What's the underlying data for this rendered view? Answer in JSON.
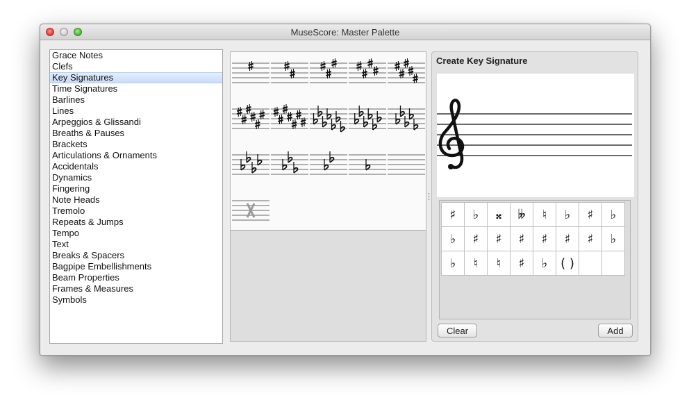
{
  "window": {
    "title": "MuseScore: Master Palette"
  },
  "categories": [
    {
      "label": "Grace Notes"
    },
    {
      "label": "Clefs"
    },
    {
      "label": "Key Signatures",
      "selected": true
    },
    {
      "label": "Time Signatures"
    },
    {
      "label": "Barlines"
    },
    {
      "label": "Lines"
    },
    {
      "label": "Arpeggios & Glissandi"
    },
    {
      "label": "Breaths & Pauses"
    },
    {
      "label": "Brackets"
    },
    {
      "label": "Articulations & Ornaments"
    },
    {
      "label": "Accidentals"
    },
    {
      "label": "Dynamics"
    },
    {
      "label": "Fingering"
    },
    {
      "label": "Note Heads"
    },
    {
      "label": "Tremolo"
    },
    {
      "label": "Repeats & Jumps"
    },
    {
      "label": "Tempo"
    },
    {
      "label": "Text"
    },
    {
      "label": "Breaks & Spacers"
    },
    {
      "label": "Bagpipe Embellishments"
    },
    {
      "label": "Beam Properties"
    },
    {
      "label": "Frames & Measures"
    },
    {
      "label": "Symbols"
    }
  ],
  "key_signature_palette": [
    {
      "name": "G major",
      "accidental": "sharp",
      "count": 1
    },
    {
      "name": "D major",
      "accidental": "sharp",
      "count": 2
    },
    {
      "name": "A major",
      "accidental": "sharp",
      "count": 3
    },
    {
      "name": "E major",
      "accidental": "sharp",
      "count": 4
    },
    {
      "name": "B major",
      "accidental": "sharp",
      "count": 5
    },
    {
      "name": "F# major",
      "accidental": "sharp",
      "count": 6
    },
    {
      "name": "C# major",
      "accidental": "sharp",
      "count": 7
    },
    {
      "name": "Cb major",
      "accidental": "flat",
      "count": 7
    },
    {
      "name": "Gb major",
      "accidental": "flat",
      "count": 6
    },
    {
      "name": "Db major",
      "accidental": "flat",
      "count": 5
    },
    {
      "name": "Ab major",
      "accidental": "flat",
      "count": 4
    },
    {
      "name": "Eb major",
      "accidental": "flat",
      "count": 3
    },
    {
      "name": "Bb major",
      "accidental": "flat",
      "count": 2
    },
    {
      "name": "F major",
      "accidental": "flat",
      "count": 1
    },
    {
      "name": "C major",
      "accidental": "none",
      "count": 0
    },
    {
      "name": "Open",
      "accidental": "x",
      "count": 0
    }
  ],
  "create_key_signature": {
    "title": "Create Key Signature",
    "clef_icon": "treble-clef-icon",
    "accidentals": [
      [
        "♯",
        "♭",
        "𝄪",
        "𝄫",
        "♮",
        "♭",
        "♯",
        "♭"
      ],
      [
        "♭",
        "♯",
        "♯",
        "♯",
        "♯",
        "♯",
        "♯",
        "♭"
      ],
      [
        "♭",
        "♮",
        "♮",
        "♯",
        "♭",
        "( )",
        "",
        ""
      ]
    ],
    "clear_label": "Clear",
    "add_label": "Add"
  }
}
